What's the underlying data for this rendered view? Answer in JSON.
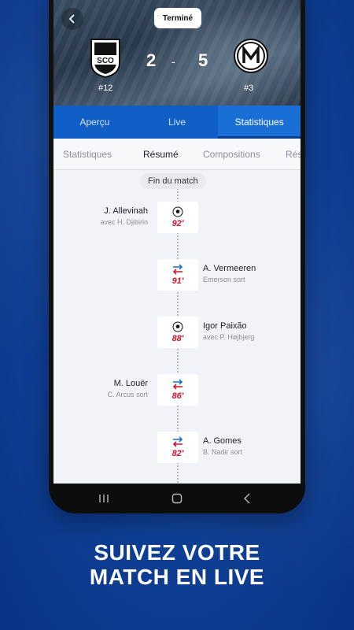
{
  "header": {
    "status": "Terminé",
    "home": {
      "rank": "#12",
      "score": "2",
      "logo_text": "SCO"
    },
    "separator": "-",
    "away": {
      "rank": "#3",
      "score": "5"
    }
  },
  "tabs_main": [
    "Aperçu",
    "Live",
    "Statistiques"
  ],
  "tabs_sub": [
    "Statistiques",
    "Résumé",
    "Compositions",
    "Rés"
  ],
  "timeline": {
    "end_label": "Fin du match",
    "events": [
      {
        "type": "goal",
        "side": "left",
        "minute": "92'",
        "player": "J. Allevinah",
        "detail": "avec H. Djibirin"
      },
      {
        "type": "sub",
        "side": "right",
        "minute": "91'",
        "player": "A. Vermeeren",
        "detail": "Emerson sort"
      },
      {
        "type": "goal",
        "side": "right",
        "minute": "88'",
        "player": "Igor Paixão",
        "detail": "avec P. Højbjerg"
      },
      {
        "type": "sub",
        "side": "left",
        "minute": "86'",
        "player": "M. Louër",
        "detail": "C. Arcus sort"
      },
      {
        "type": "sub",
        "side": "right",
        "minute": "82'",
        "player": "A. Gomes",
        "detail": "B. Nadir sort"
      }
    ]
  },
  "tagline": {
    "line1": "SUIVEZ VOTRE",
    "line2": "MATCH EN LIVE"
  },
  "colors": {
    "accent": "#0f5fc7",
    "minute": "#d3142e",
    "background": "#0e3f95"
  }
}
